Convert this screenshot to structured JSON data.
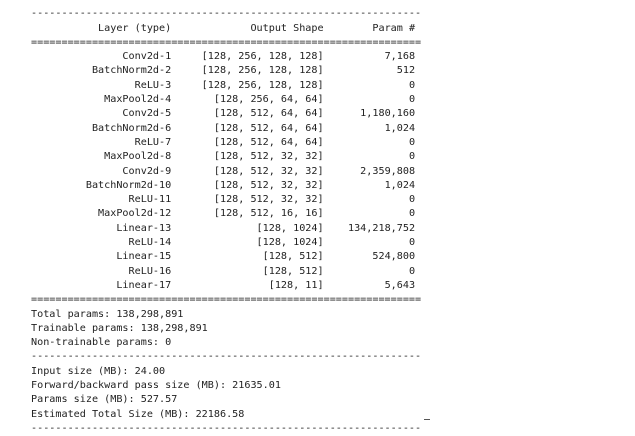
{
  "summary": {
    "top_partial_line": "          -----------------          ----------------------",
    "dash_line": "----------------------------------------------------------------",
    "equals_line": "================================================================",
    "headers": {
      "layer": "Layer (type)",
      "shape": "Output Shape",
      "param": "Param #"
    },
    "rows": [
      {
        "layer": "Conv2d-1",
        "shape": "[128, 256, 128, 128]",
        "param": "7,168"
      },
      {
        "layer": "BatchNorm2d-2",
        "shape": "[128, 256, 128, 128]",
        "param": "512"
      },
      {
        "layer": "ReLU-3",
        "shape": "[128, 256, 128, 128]",
        "param": "0"
      },
      {
        "layer": "MaxPool2d-4",
        "shape": "[128, 256, 64, 64]",
        "param": "0"
      },
      {
        "layer": "Conv2d-5",
        "shape": "[128, 512, 64, 64]",
        "param": "1,180,160"
      },
      {
        "layer": "BatchNorm2d-6",
        "shape": "[128, 512, 64, 64]",
        "param": "1,024"
      },
      {
        "layer": "ReLU-7",
        "shape": "[128, 512, 64, 64]",
        "param": "0"
      },
      {
        "layer": "MaxPool2d-8",
        "shape": "[128, 512, 32, 32]",
        "param": "0"
      },
      {
        "layer": "Conv2d-9",
        "shape": "[128, 512, 32, 32]",
        "param": "2,359,808"
      },
      {
        "layer": "BatchNorm2d-10",
        "shape": "[128, 512, 32, 32]",
        "param": "1,024"
      },
      {
        "layer": "ReLU-11",
        "shape": "[128, 512, 32, 32]",
        "param": "0"
      },
      {
        "layer": "MaxPool2d-12",
        "shape": "[128, 512, 16, 16]",
        "param": "0"
      },
      {
        "layer": "Linear-13",
        "shape": "[128, 1024]",
        "param": "134,218,752"
      },
      {
        "layer": "ReLU-14",
        "shape": "[128, 1024]",
        "param": "0"
      },
      {
        "layer": "Linear-15",
        "shape": "[128, 512]",
        "param": "524,800"
      },
      {
        "layer": "ReLU-16",
        "shape": "[128, 512]",
        "param": "0"
      },
      {
        "layer": "Linear-17",
        "shape": "[128, 11]",
        "param": "5,643"
      }
    ],
    "totals": {
      "total": "Total params: 138,298,891",
      "trainable": "Trainable params: 138,298,891",
      "non_trainable": "Non-trainable params: 0"
    },
    "sizes": {
      "input": "Input size (MB): 24.00",
      "forward_backward": "Forward/backward pass size (MB): 21635.01",
      "params": "Params size (MB): 527.57",
      "estimated_total": "Estimated Total Size (MB): 22186.58"
    }
  }
}
